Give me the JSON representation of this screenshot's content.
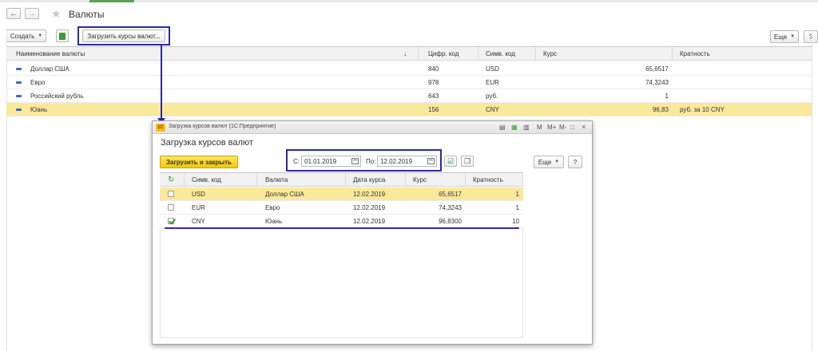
{
  "window": {
    "title": "Валюты",
    "back_icon": "←",
    "forward_icon": "→",
    "star_icon": "★"
  },
  "toolbar": {
    "create_label": "Создать",
    "load_rates_label": "Загрузить курсы валют...",
    "more_label": "Еще",
    "help_label": "?"
  },
  "grid": {
    "columns": [
      "Наименование валюты",
      "Цифр. код",
      "Симв. код",
      "Курс",
      "Кратность"
    ],
    "sort_icon": "↓",
    "rows": [
      {
        "name": "Доллар США",
        "num_code": "840",
        "sym_code": "USD",
        "rate": "65,6517",
        "mult": "",
        "selected": false
      },
      {
        "name": "Евро",
        "num_code": "978",
        "sym_code": "EUR",
        "rate": "74,3243",
        "mult": "",
        "selected": false
      },
      {
        "name": "Российский рубль",
        "num_code": "643",
        "sym_code": "руб.",
        "rate": "1",
        "mult": "",
        "selected": false
      },
      {
        "name": "Юань",
        "num_code": "156",
        "sym_code": "CNY",
        "rate": "96,83",
        "mult": "руб. за 10 CNY",
        "selected": true
      }
    ]
  },
  "dialog": {
    "window_title": "Загрузка курсов валют  (1С:Предприятие)",
    "logo_text": "1С",
    "heading": "Загрузка курсов валют",
    "load_close_label": "Загрузить и закрыть",
    "from_label": "С:",
    "from_value": "01.01.2019",
    "to_label": "По:",
    "to_value": "12.02.2019",
    "more_label": "Еще",
    "help_label": "?",
    "title_icons": [
      "M",
      "M+",
      "M-",
      "□",
      "×"
    ],
    "columns": [
      "Симв. код",
      "Валюта",
      "Дата курса",
      "Курс",
      "Кратность"
    ],
    "refresh_icon": "↻",
    "rows": [
      {
        "checked": false,
        "sym_code": "USD",
        "currency": "Доллар США",
        "date": "12.02.2019",
        "rate": "65,6517",
        "mult": "1",
        "selected": true
      },
      {
        "checked": false,
        "sym_code": "EUR",
        "currency": "Евро",
        "date": "12.02.2019",
        "rate": "74,3243",
        "mult": "1",
        "selected": false
      },
      {
        "checked": true,
        "sym_code": "CNY",
        "currency": "Юань",
        "date": "12.02.2019",
        "rate": "96,8300",
        "mult": "10",
        "selected": false
      }
    ]
  },
  "colors": {
    "selection": "#fbe99b",
    "accent_yellow": "#f4c800",
    "annotation_blue": "#2a2aa0"
  }
}
